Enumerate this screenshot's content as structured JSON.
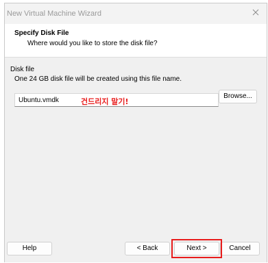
{
  "window": {
    "title": "New Virtual Machine Wizard"
  },
  "header": {
    "title": "Specify Disk File",
    "subtitle": "Where would you like to store the disk file?"
  },
  "disk_file": {
    "group_label": "Disk file",
    "description": "One 24 GB disk file will be created using this file name.",
    "file_name": "Ubuntu.vmdk",
    "annotation": "건드리지 말기!",
    "browse_label": "Browse..."
  },
  "footer": {
    "help_label": "Help",
    "back_label": "< Back",
    "next_label": "Next >",
    "cancel_label": "Cancel"
  },
  "icons": {
    "close": "close-icon"
  },
  "colors": {
    "annotation": "#e81b1b",
    "highlight": "#e81b1b",
    "title_text": "#9a9a9a"
  }
}
